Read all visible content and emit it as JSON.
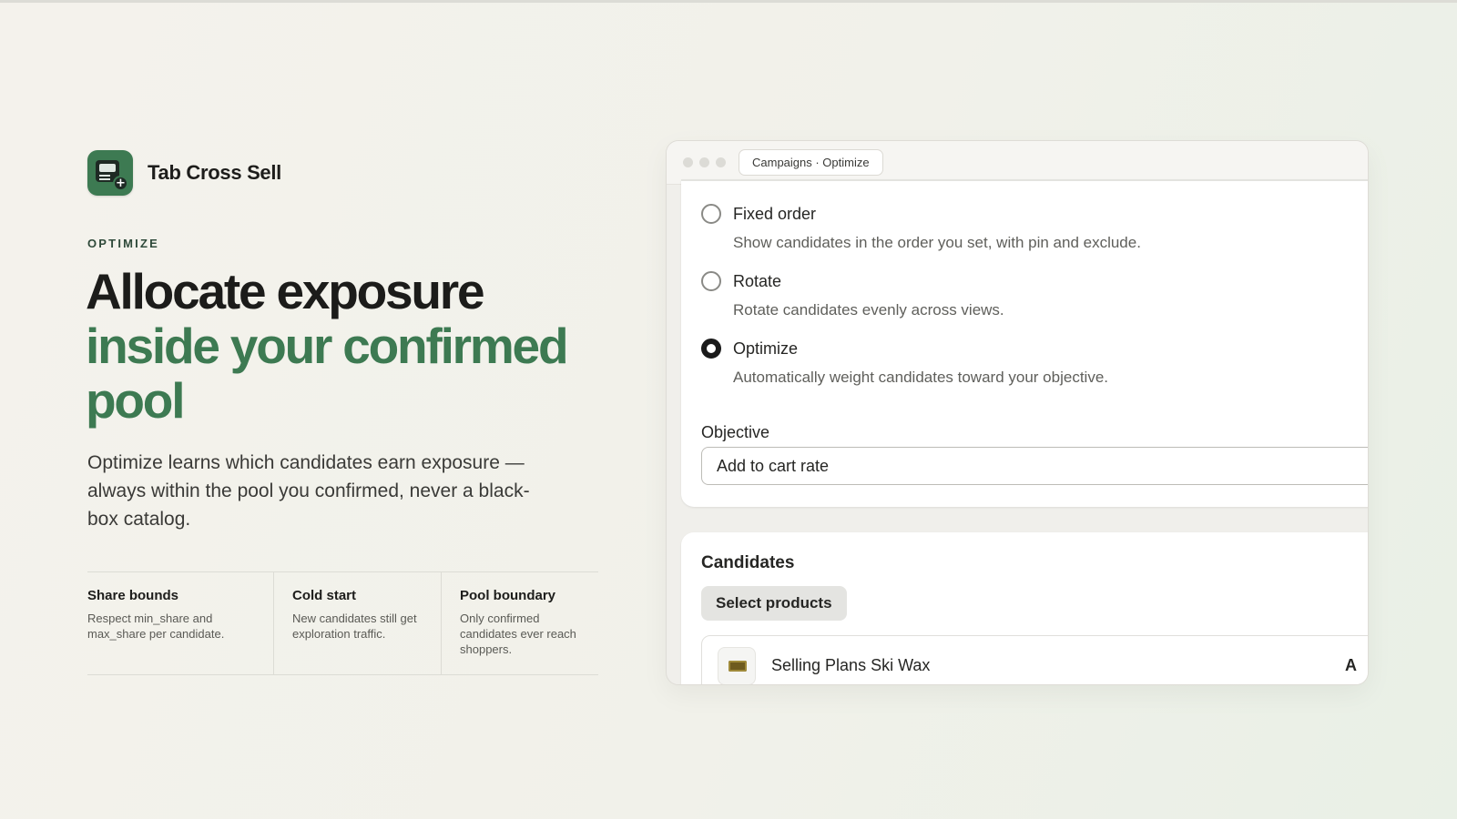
{
  "app": {
    "name": "Tab Cross Sell",
    "icon": "app-cross-sell-icon",
    "brand_color": "#3d7a52"
  },
  "eyebrow": "OPTIMIZE",
  "headline": {
    "line1": "Allocate exposure",
    "line2": "inside your confirmed",
    "line3": "pool"
  },
  "lede": "Optimize learns which candidates earn exposure — always within the pool you confirmed, never a black-box catalog.",
  "features": [
    {
      "title": "Share bounds",
      "text": "Respect min_share and max_share per candidate."
    },
    {
      "title": "Cold start",
      "text": "New candidates still get exploration traffic."
    },
    {
      "title": "Pool boundary",
      "text": "Only confirmed candidates ever reach shoppers."
    }
  ],
  "window": {
    "address": "Campaigns · Optimize",
    "options": [
      {
        "label": "Fixed order",
        "help": "Show candidates in the order you set, with pin and exclude.",
        "checked": false
      },
      {
        "label": "Rotate",
        "help": "Rotate candidates evenly across views.",
        "checked": false
      },
      {
        "label": "Optimize",
        "help": "Automatically weight candidates toward your objective.",
        "checked": true
      }
    ],
    "objective_label": "Objective",
    "objective_value": "Add to cart rate",
    "candidates_title": "Candidates",
    "select_button": "Select products",
    "products": [
      {
        "name": "Selling Plans Ski Wax",
        "action": "A"
      }
    ]
  }
}
